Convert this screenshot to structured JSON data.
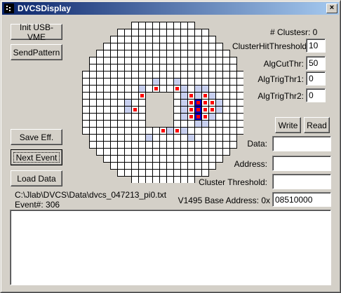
{
  "window": {
    "title": "DVCSDisplay",
    "close_glyph": "×"
  },
  "buttons": {
    "init_usb": "Init USB-VME",
    "send_pattern": "SendPattern",
    "save_eff": "Save Eff.",
    "next_event": "Next Event",
    "load_data": "Load Data",
    "write": "Write",
    "read": "Read"
  },
  "params": {
    "clusters_label": "# Clustesr: 0",
    "cluster_hit_threshold_label": "ClusterHitThreshold:",
    "cluster_hit_threshold_value": "10",
    "alg_cut_thr_label": "AlgCutThr:",
    "alg_cut_thr_value": "50",
    "alg_trig_thr1_label": "AlgTrigThr1:",
    "alg_trig_thr1_value": "0",
    "alg_trig_thr2_label": "AlgTrigThr2:",
    "alg_trig_thr2_value": "0"
  },
  "registers": {
    "data_label": "Data:",
    "data_value": "",
    "address_label": "Address:",
    "address_value": "",
    "cluster_threshold_label": "Cluster Threshold:",
    "cluster_threshold_value": "",
    "base_address_label": "V1495 Base Address: 0x",
    "base_address_value": "08510000"
  },
  "file": {
    "path": "C:\\Jlab\\DVCS\\Data\\dvcs_047213_pi0.txt",
    "event": "Event#: 306"
  },
  "log": {
    "text": ""
  },
  "detector": {
    "grid_columns": 23,
    "grid_rows": 23,
    "row_spans": [
      [
        7,
        15
      ],
      [
        5,
        17
      ],
      [
        4,
        18
      ],
      [
        3,
        19
      ],
      [
        2,
        20
      ],
      [
        1,
        21
      ],
      [
        1,
        21
      ],
      [
        0,
        22
      ],
      [
        0,
        22
      ],
      [
        0,
        22
      ],
      [
        0,
        22
      ],
      [
        0,
        22
      ],
      [
        0,
        22
      ],
      [
        0,
        22
      ],
      [
        0,
        22
      ],
      [
        0,
        22
      ],
      [
        1,
        21
      ],
      [
        1,
        21
      ],
      [
        2,
        20
      ],
      [
        3,
        19
      ],
      [
        4,
        18
      ],
      [
        5,
        17
      ],
      [
        7,
        15
      ]
    ],
    "hole": {
      "cols": [
        9,
        12
      ],
      "rows": [
        10,
        14
      ]
    },
    "hit_cells": [
      [
        10,
        9
      ],
      [
        13,
        9
      ],
      [
        8,
        10
      ],
      [
        15,
        10
      ],
      [
        17,
        10
      ],
      [
        15,
        11
      ],
      [
        17,
        11
      ],
      [
        18,
        11
      ],
      [
        7,
        12
      ],
      [
        15,
        12
      ],
      [
        17,
        12
      ],
      [
        18,
        12
      ],
      [
        15,
        13
      ],
      [
        17,
        13
      ],
      [
        11,
        15
      ],
      [
        13,
        15
      ]
    ],
    "cluster_cells": [
      [
        16,
        11
      ],
      [
        16,
        12
      ],
      [
        16,
        13
      ]
    ],
    "halo_cells": [
      [
        10,
        8
      ],
      [
        13,
        8
      ],
      [
        8,
        9
      ],
      [
        14,
        9
      ],
      [
        16,
        9
      ],
      [
        17,
        9
      ],
      [
        14,
        10
      ],
      [
        16,
        10
      ],
      [
        18,
        10
      ],
      [
        14,
        11
      ],
      [
        19,
        11
      ],
      [
        14,
        12
      ],
      [
        19,
        12
      ],
      [
        14,
        13
      ],
      [
        18,
        13
      ],
      [
        16,
        14
      ],
      [
        17,
        14
      ],
      [
        12,
        15
      ],
      [
        14,
        15
      ],
      [
        6,
        11
      ],
      [
        6,
        12
      ],
      [
        9,
        16
      ],
      [
        15,
        16
      ]
    ],
    "colors": {
      "cell_fill": "#ffffff",
      "grid_line": "#000000",
      "hit": "#ff0000",
      "cluster": "#0000c8",
      "halo": "#c8d0f0"
    }
  }
}
